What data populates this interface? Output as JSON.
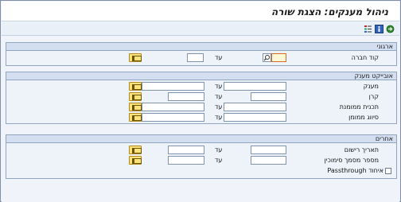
{
  "window": {
    "title": "ניהול מענקים: הצגת שורה"
  },
  "toolbar": {
    "icons": [
      "execute-icon",
      "info-icon",
      "menu-icon"
    ]
  },
  "org": {
    "header": "ארגוני",
    "company_code_label": "קוד חברה",
    "to_label": "עד"
  },
  "grant_obj": {
    "header": "אובייקט מענק",
    "rows": [
      {
        "label": "מענק",
        "to": "עד"
      },
      {
        "label": "קרן",
        "to": "עד"
      },
      {
        "label": "תכנית ממומנת",
        "to": "עד"
      },
      {
        "label": "סיווג ממומן",
        "to": "עד"
      }
    ]
  },
  "other": {
    "header": "אחרים",
    "rows": [
      {
        "label": "תאריך רישום",
        "to": "עד"
      },
      {
        "label": "מספר מסמך סימוכין",
        "to": "עד"
      }
    ],
    "checkbox_label": "איחוד Passthrough"
  }
}
